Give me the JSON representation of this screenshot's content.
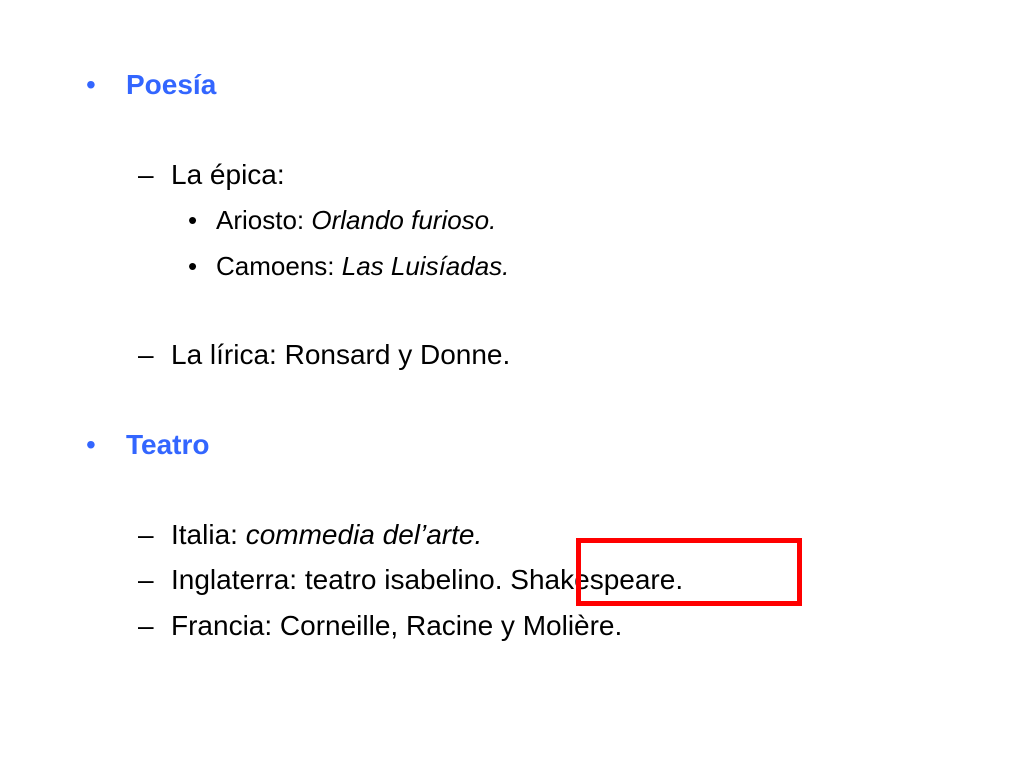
{
  "bullet_char": "•",
  "dash_char": "–",
  "sections": [
    {
      "heading": "Poesía",
      "items": [
        {
          "label": "La épica:",
          "subitems": [
            {
              "author": "Ariosto: ",
              "work": "Orlando furioso."
            },
            {
              "author": "Camoens: ",
              "work": "Las Luisíadas."
            }
          ]
        },
        {
          "label": "La lírica: Ronsard y Donne."
        }
      ]
    },
    {
      "heading": "Teatro",
      "items": [
        {
          "label": "Italia: ",
          "italic": "commedia del’arte."
        },
        {
          "label": "Inglaterra: teatro isabelino. Shakespeare."
        },
        {
          "label": "Francia: Corneille, Racine y Molière."
        }
      ]
    }
  ],
  "colors": {
    "heading": "#3366ff",
    "highlight": "#ff0000",
    "text": "#000000"
  }
}
